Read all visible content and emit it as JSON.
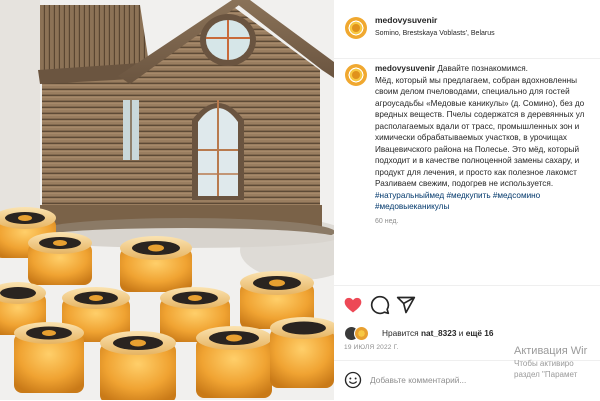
{
  "post": {
    "username": "medovysuvenir",
    "location": "Somino, Brestskaya Voblasts', Belarus",
    "caption_lines": [
      "Давайте познакомимся.",
      "Мёд, который мы предлагаем, собран вдохновленны",
      "своим делом пчеловодами, специально для гостей",
      "агроусадьбы «Медовые каникулы» (д. Сомино), без до",
      "вредных веществ. Пчелы содержатся в деревянных ул",
      "располагаемых вдали от трасс, промышленных зон и",
      "химически обрабатываемых участков, в урочищах",
      "Ивацевичского района на Полесье. Это мёд, который",
      "подходит и в качестве полноценной замены сахару, и",
      "продукт для лечения, и просто как полезное лакомст",
      "Разливаем свежим, подогрев не используется."
    ],
    "hashtags_line1": "#натуральныймед #медкупить #медсомино",
    "hashtags_line2": "#медовыеканикулы",
    "age": "60 нед.",
    "likes_prefix": "Нравится",
    "likes_user": "nat_8323",
    "likes_conj": "и",
    "likes_rest": "ещё 16",
    "date": "19 ИЮЛЯ 2022 Г.",
    "comment_placeholder": "Добавьте комментарий..."
  },
  "icons": {
    "like": "heart-icon",
    "comment": "comment-icon",
    "share": "share-icon",
    "emoji": "emoji-icon"
  },
  "colors": {
    "like_red": "#ed4956",
    "hashtag_blue": "#00376b",
    "honey": "#e8a030",
    "label_dark": "#2a2420"
  },
  "watermark": {
    "title": "Активация Wir",
    "sub1": "Чтобы активиро",
    "sub2": "раздел \"Парамет"
  }
}
